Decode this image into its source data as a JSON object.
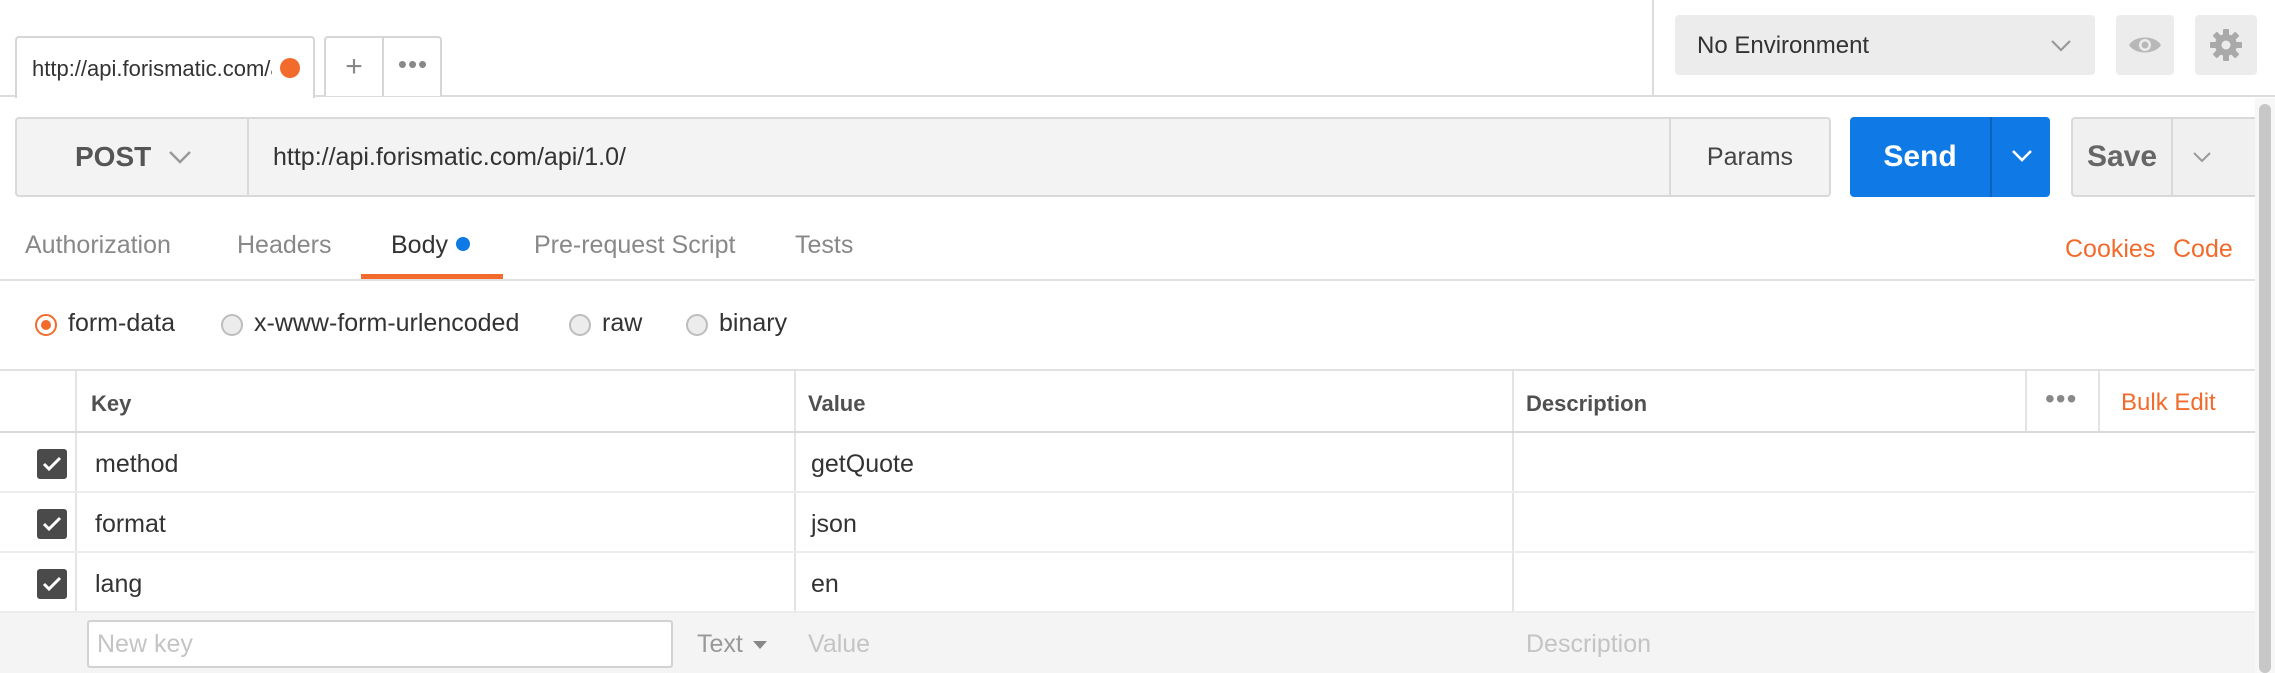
{
  "tabs": {
    "active_tab_title": "http://api.forismatic.com/api/1.0/",
    "new_tab_label": "+",
    "more_label": "•••"
  },
  "environment": {
    "selected": "No Environment"
  },
  "request": {
    "method": "POST",
    "url": "http://api.forismatic.com/api/1.0/",
    "params_label": "Params",
    "send_label": "Send",
    "save_label": "Save"
  },
  "subtabs": {
    "items": [
      "Authorization",
      "Headers",
      "Body",
      "Pre-request Script",
      "Tests"
    ],
    "active": "Body",
    "cookies_label": "Cookies",
    "code_label": "Code"
  },
  "body_types": {
    "options": [
      "form-data",
      "x-www-form-urlencoded",
      "raw",
      "binary"
    ],
    "selected": "form-data"
  },
  "table": {
    "headers": {
      "key": "Key",
      "value": "Value",
      "description": "Description"
    },
    "bulk_edit_label": "Bulk Edit",
    "more_label": "•••",
    "rows": [
      {
        "checked": true,
        "key": "method",
        "value": "getQuote",
        "description": ""
      },
      {
        "checked": true,
        "key": "format",
        "value": "json",
        "description": ""
      },
      {
        "checked": true,
        "key": "lang",
        "value": "en",
        "description": ""
      }
    ],
    "new_row": {
      "key_placeholder": "New key",
      "type": "Text",
      "value_placeholder": "Value",
      "description_placeholder": "Description"
    }
  },
  "colors": {
    "accent": "#f26b2c",
    "primary": "#0f7ae6"
  }
}
